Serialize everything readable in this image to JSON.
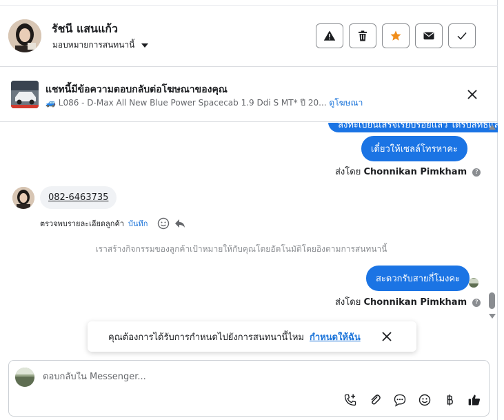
{
  "header": {
    "contact_name": "รัชนี แสนแก้ว",
    "assign_label": "มอบหมายการสนทนานี้",
    "actions": [
      "spam-icon",
      "trash-icon",
      "star-icon",
      "envelope-icon",
      "check-icon"
    ],
    "star_color": "#f08d1a"
  },
  "ad_banner": {
    "title": "แชทนี้มีข้อความตอบกลับต่อโฆษณาของคุณ",
    "subtitle": "🚙 L086 - D-Max All New Blue Power Spacecab 1.9 Ddi S MT* ปี 20...",
    "link": "ดูโฆษณา"
  },
  "messages": {
    "out_top_partial": "ลงทะเบียนเสร็จเรียบร้อยแล้ว ได้รับสิทธิ์แล้ว",
    "out_1": "เดี๋ยวให้เซลล์โทรหาคะ",
    "sent_by_prefix": "ส่งโดย",
    "sender_name": "Chonnikan Pimkham",
    "in_phone": "082-6463735",
    "in_detail": "ตรวจพบรายละเอียดลูกค้า",
    "in_save": "บันทึก",
    "system_note": "เราสร้างกิจกรรมของลูกค้าเป้าหมายให้กับคุณโดยอัตโนมัติโดยอิงตามการสนทนานี้",
    "out_2": "สะดวกรับสายกี่โมงคะ"
  },
  "toast": {
    "text": "คุณต้องการได้รับการกำหนดไปยังการสนทนานี้ไหม",
    "link": "กำหนดให้ฉัน"
  },
  "composer": {
    "placeholder": "ตอบกลับใน Messenger...",
    "tools": [
      "add-call-icon",
      "attach-icon",
      "saved-reply-icon",
      "emoji-icon",
      "baht-icon",
      "like-icon"
    ]
  },
  "colors": {
    "accent": "#1b74e4",
    "link": "#1a73d9"
  }
}
